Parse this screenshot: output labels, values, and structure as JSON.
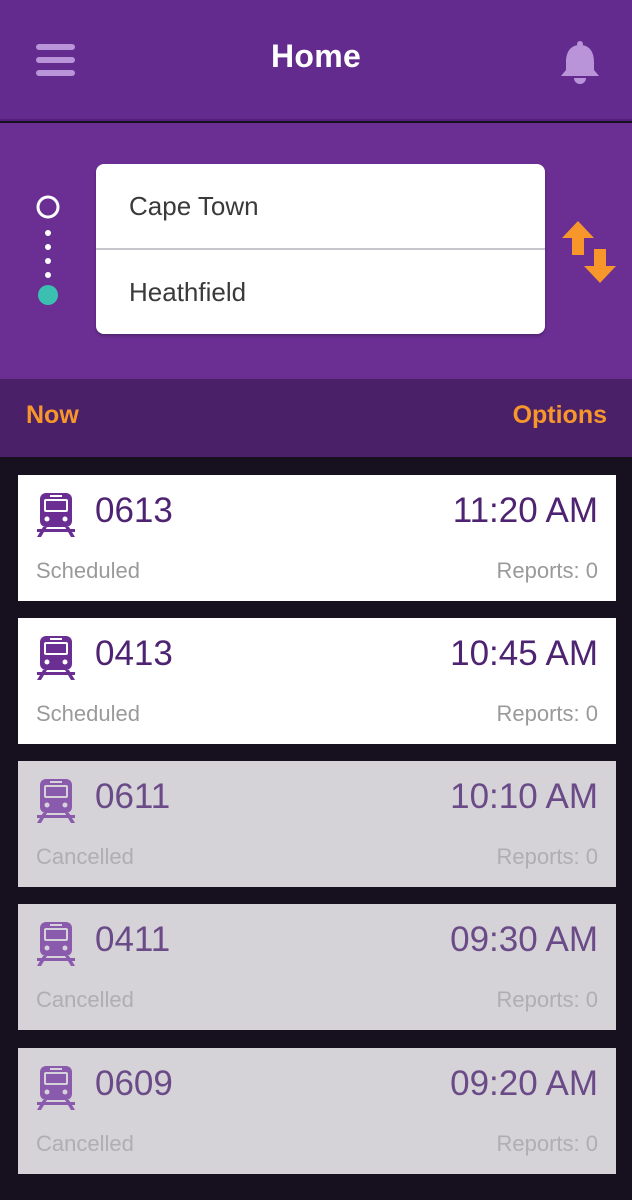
{
  "header": {
    "title": "Home",
    "menu_icon": "hamburger-menu-icon",
    "notification_icon": "bell-icon"
  },
  "route": {
    "from": "Cape Town",
    "to": "Heathfield",
    "swap_icon": "swap-arrows-icon"
  },
  "options_bar": {
    "now_label": "Now",
    "options_label": "Options"
  },
  "trips": [
    {
      "train": "0613",
      "time": "11:20 AM",
      "status": "Scheduled",
      "reports": "Reports: 0",
      "cancelled": false
    },
    {
      "train": "0413",
      "time": "10:45 AM",
      "status": "Scheduled",
      "reports": "Reports: 0",
      "cancelled": false
    },
    {
      "train": "0611",
      "time": "10:10 AM",
      "status": "Cancelled",
      "reports": "Reports: 0",
      "cancelled": true
    },
    {
      "train": "0411",
      "time": "09:30 AM",
      "status": "Cancelled",
      "reports": "Reports: 0",
      "cancelled": true
    },
    {
      "train": "0609",
      "time": "09:20 AM",
      "status": "Cancelled",
      "reports": "Reports: 0",
      "cancelled": true
    }
  ],
  "colors": {
    "appbar": "#642b8e",
    "route_bg": "#6b2f94",
    "options_bg": "#4a2169",
    "accent_orange": "#f7962a",
    "origin_marker": "#ffffff",
    "destination_marker": "#3bbfb0",
    "train_icon": "#6b2f94"
  }
}
